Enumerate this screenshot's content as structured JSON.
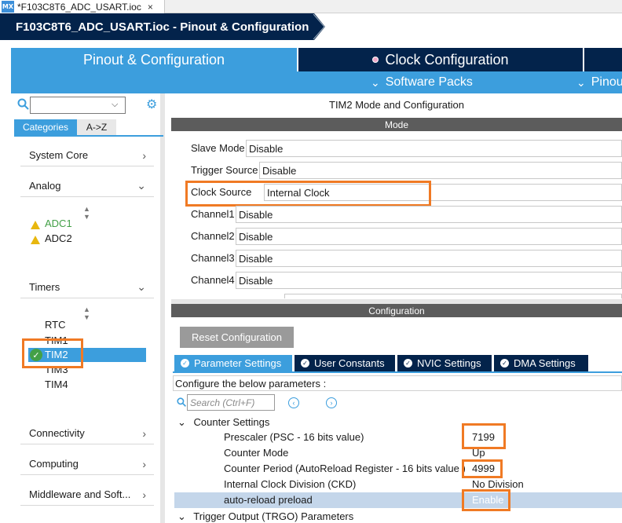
{
  "file_tab": {
    "icon": "MX",
    "title": "*F103C8T6_ADC_USART.ioc",
    "close": "×"
  },
  "breadcrumb": {
    "text": "F103C8T6_ADC_USART.ioc - Pinout & Configuration"
  },
  "main_tabs": {
    "pinout": "Pinout & Configuration",
    "clock": "Clock Configuration"
  },
  "sub_menu": {
    "software_packs": "Software Packs",
    "pinout": "Pinout"
  },
  "left": {
    "tab_categories": "Categories",
    "tab_az": "A->Z",
    "groups": {
      "system_core": "System Core",
      "analog": "Analog",
      "timers": "Timers",
      "connectivity": "Connectivity",
      "computing": "Computing",
      "middleware": "Middleware and Soft..."
    },
    "analog_items": [
      "ADC1",
      "ADC2"
    ],
    "timer_items": [
      "RTC",
      "TIM1",
      "TIM2",
      "TIM3",
      "TIM4"
    ]
  },
  "right": {
    "title": "TIM2 Mode and Configuration",
    "mode_header": "Mode",
    "mode_rows": [
      {
        "label": "Slave Mode",
        "value": "Disable"
      },
      {
        "label": "Trigger Source",
        "value": "Disable"
      },
      {
        "label": "Clock Source",
        "value": "Internal Clock"
      },
      {
        "label": "Channel1",
        "value": "Disable"
      },
      {
        "label": "Channel2",
        "value": "Disable"
      },
      {
        "label": "Channel3",
        "value": "Disable"
      },
      {
        "label": "Channel4",
        "value": "Disable"
      }
    ],
    "config_header": "Configuration",
    "reset_button": "Reset Configuration",
    "param_tabs": [
      "Parameter Settings",
      "User Constants",
      "NVIC Settings",
      "DMA Settings"
    ],
    "hint": "Configure the below parameters :",
    "search_placeholder": "Search (Ctrl+F)",
    "counter_group": "Counter Settings",
    "params": [
      {
        "name": "Prescaler (PSC - 16 bits value)",
        "value": "7199"
      },
      {
        "name": "Counter Mode",
        "value": "Up"
      },
      {
        "name": "Counter Period (AutoReload Register - 16 bits value )",
        "value": "4999"
      },
      {
        "name": "Internal Clock Division (CKD)",
        "value": "No Division"
      },
      {
        "name": "auto-reload preload",
        "value": "Enable"
      }
    ],
    "trgo_group": "Trigger Output (TRGO) Parameters"
  },
  "colors": {
    "navy": "#03234b",
    "blue": "#3c9edd",
    "highlight": "#f07a24",
    "warning": "#e8b70e",
    "ok": "#43a047"
  }
}
